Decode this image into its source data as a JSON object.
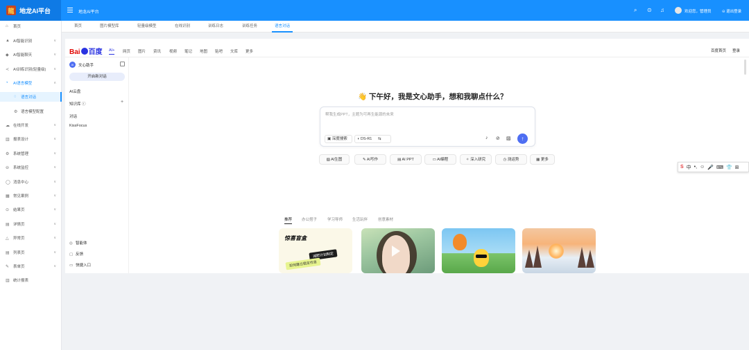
{
  "app": {
    "title": "地龙AI平台",
    "logo_char": "龍",
    "system_name": "地龙AI平台",
    "brand_color": "#1890ff"
  },
  "header": {
    "icons": [
      "search-icon",
      "help-icon",
      "bell-icon"
    ],
    "welcome": "欢迎您，管理员",
    "logout": "退出登录"
  },
  "sidebar": {
    "items": [
      {
        "label": "首页",
        "icon": "home-icon",
        "arrow": false
      },
      {
        "label": "AI智能识别",
        "icon": "ai-detect-icon",
        "arrow": true
      },
      {
        "label": "AI智能聊天",
        "icon": "ai-chat-icon",
        "arrow": true
      },
      {
        "label": "AI训练识别(轻量级)",
        "icon": "training-icon",
        "arrow": true
      },
      {
        "label": "AI语言模型",
        "icon": "language-model-icon",
        "arrow": true,
        "expanded": true
      },
      {
        "label": "语言对话",
        "icon": "dialog-icon",
        "arrow": false,
        "sub": true,
        "active": true
      },
      {
        "label": "语言模型配置",
        "icon": "config-icon",
        "arrow": false,
        "sub": true
      },
      {
        "label": "在线开发",
        "icon": "cloud-icon",
        "arrow": true
      },
      {
        "label": "报表设计",
        "icon": "report-icon",
        "arrow": true
      },
      {
        "label": "系统管理",
        "icon": "settings-icon",
        "arrow": true
      },
      {
        "label": "系统监控",
        "icon": "monitor-icon",
        "arrow": true
      },
      {
        "label": "消息中心",
        "icon": "message-icon",
        "arrow": true
      },
      {
        "label": "常见案例",
        "icon": "case-icon",
        "arrow": true
      },
      {
        "label": "结果页",
        "icon": "result-icon",
        "arrow": true
      },
      {
        "label": "详情页",
        "icon": "detail-icon",
        "arrow": true
      },
      {
        "label": "异常页",
        "icon": "warning-icon",
        "arrow": true
      },
      {
        "label": "列表页",
        "icon": "list-icon",
        "arrow": true
      },
      {
        "label": "表单页",
        "icon": "form-icon",
        "arrow": true
      },
      {
        "label": "统计报表",
        "icon": "chart-icon",
        "arrow": false
      }
    ]
  },
  "tabs": [
    "首页",
    "图片模型库",
    "轻量级模型",
    "在线识别",
    "训练日志",
    "训练任务",
    "语言对话"
  ],
  "baidu": {
    "logo_bai": "Bai",
    "logo_du": "百度",
    "nav": [
      "AI+",
      "网页",
      "图片",
      "资讯",
      "视频",
      "笔记",
      "地图",
      "贴吧",
      "文库",
      "更多"
    ],
    "right_links": [
      "百度首页",
      "登录"
    ],
    "assistant_name": "文心助手",
    "ai_avatar": "AI",
    "new_chat": "开启新对话",
    "ai_cloud": "AI云盘",
    "knowledge_base": "知识库 ⓘ",
    "dialog_header": "对话",
    "dialog_item": "KissFocus",
    "bottom_links": [
      "智能体",
      "反馈",
      "快捷入口"
    ],
    "greeting": "👋 下午好，我是文心助手，想和我聊点什么？",
    "input_placeholder": "帮我生成PPT，主题为可再生能源的未来",
    "deep_search": "深度搜索",
    "model": "DS-R1",
    "quick_actions": [
      "AI生图",
      "AI写作",
      "AI PPT",
      "AI编程",
      "深入研究",
      "测运势",
      "更多"
    ],
    "content_tabs": [
      "推荐",
      "办公搭子",
      "学习导师",
      "生活玩伴",
      "创意素材"
    ],
    "card1_title": "惊喜盲盒",
    "card1_tag1": "减肥计划制定",
    "card1_tag2": "如何建立稳定作息"
  },
  "float_toolbar": [
    "S",
    "中",
    "•,",
    "☺",
    "🎤",
    "⌨",
    "👕",
    "⊞"
  ]
}
